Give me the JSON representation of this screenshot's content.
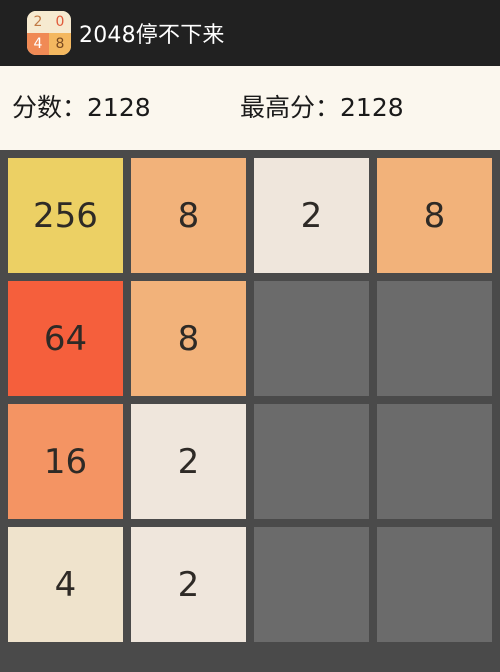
{
  "app": {
    "title": "2048停不下来",
    "icon_digits": {
      "tl": "2",
      "tr": "0",
      "bl": "4",
      "br": "8"
    }
  },
  "scores": {
    "current_label": "分数：",
    "current_value": "2128",
    "best_label": "最高分：",
    "best_value": "2128"
  },
  "board": {
    "rows": [
      [
        "256",
        "8",
        "2",
        "8"
      ],
      [
        "64",
        "8",
        "",
        ""
      ],
      [
        "16",
        "2",
        "",
        ""
      ],
      [
        "4",
        "2",
        "",
        ""
      ]
    ]
  },
  "colors": {
    "titlebar": "#212121",
    "scorebar": "#fbf7ee",
    "board_background": "#4a4a4a",
    "empty_cell": "#6b6b6b",
    "tile_2": "#efe6dc",
    "tile_4": "#efe3cc",
    "tile_8": "#f2b27a",
    "tile_16": "#f49463",
    "tile_64": "#f55f3c",
    "tile_256": "#ecd064"
  }
}
